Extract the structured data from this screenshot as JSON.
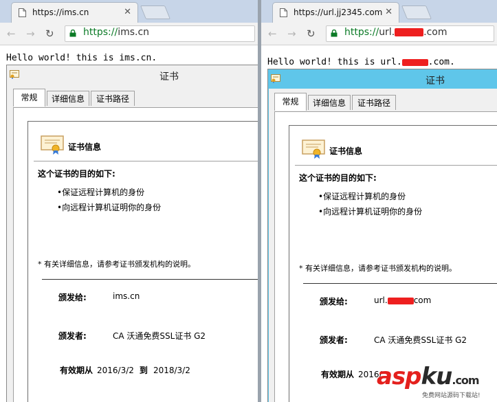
{
  "windows": [
    {
      "tab_title": "https://ims.cn",
      "url_scheme": "https://",
      "url_host": "ims.cn",
      "url_redacted": false,
      "page_text": "Hello world! this is ims.cn.",
      "page_text_end": ""
    },
    {
      "tab_title": "https://url.jj2345.com",
      "url_scheme": "https://",
      "url_host": "url.",
      "url_host_end": ".com",
      "url_redacted": true,
      "page_text": "Hello world! this is url.",
      "page_text_end": ".com."
    }
  ],
  "dialog": {
    "title": "证书",
    "tabs": [
      "常规",
      "详细信息",
      "证书路径"
    ],
    "info_heading": "证书信息",
    "purpose_heading": "这个证书的目的如下:",
    "purposes": [
      "•保证远程计算机的身份",
      "•向远程计算机证明你的身份"
    ],
    "note": "* 有关详细信息，请参考证书颁发机构的说明。",
    "issued_to_label": "颁发给:",
    "issued_by_label": "颁发者:",
    "issued_by": "CA 沃通免费SSL证书 G2",
    "validity_label": "有效期从",
    "validity_to_label": "到",
    "issued_to_1": "ims.cn",
    "valid_from_1": "2016/3/2",
    "valid_to_1": "2018/3/2",
    "issued_to_2_start": "url.",
    "issued_to_2_end": "com",
    "valid_from_2": "2016/"
  },
  "watermark": {
    "logo_asp": "asp",
    "logo_ku": "ku",
    "logo_tld": ".com",
    "subtitle": "免费网站源码下载站!"
  },
  "colors": {
    "tabstrip": "#c7d5e8",
    "url_green": "#0b7a26",
    "dialog_blue": "#5fc6ea",
    "redaction": "#ee1f1f",
    "watermark_red": "#e4201d"
  }
}
